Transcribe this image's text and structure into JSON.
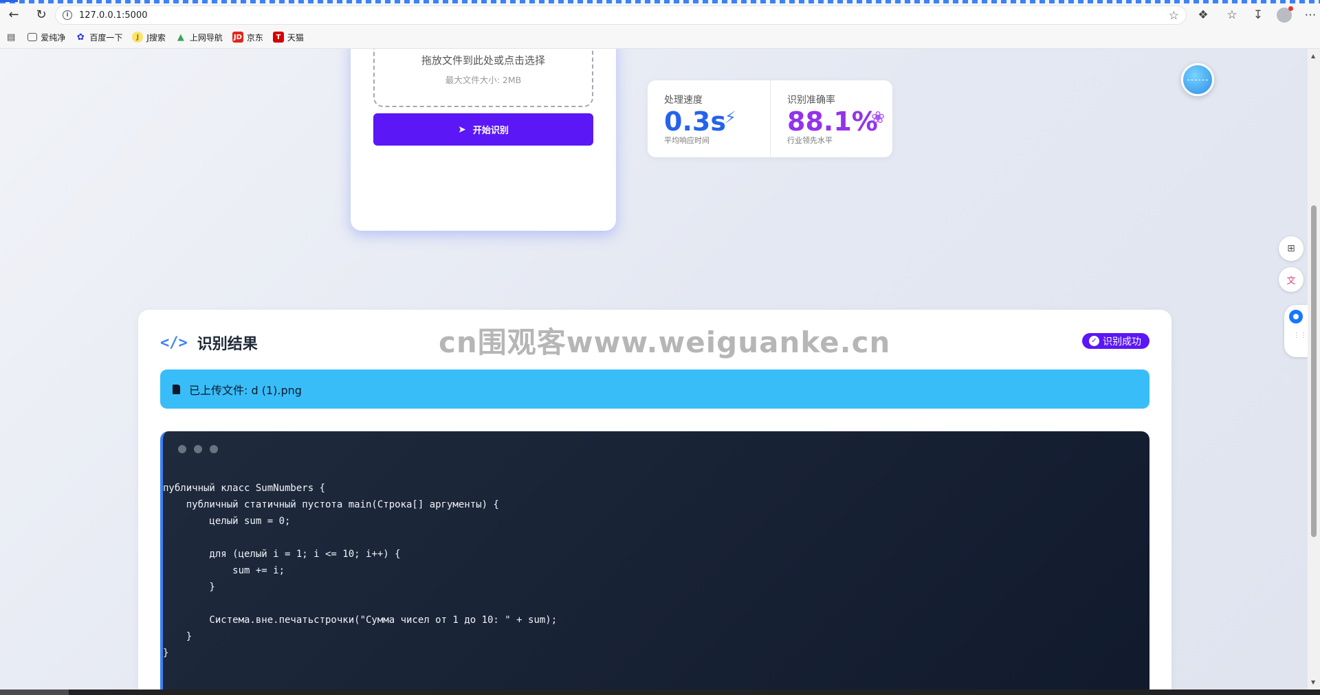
{
  "browser": {
    "url": "127.0.0.1:5000",
    "bookmarks": [
      {
        "label": "爱纯净",
        "icon": "folder-icon",
        "color": "#555555"
      },
      {
        "label": "百度一下",
        "icon": "baidu-paw-icon",
        "color": "#2932e1"
      },
      {
        "label": "J搜索",
        "icon": "jsearch-icon",
        "color": "#f5c518"
      },
      {
        "label": "上网导航",
        "icon": "nav-icon",
        "color": "#3aa55a"
      },
      {
        "label": "京东",
        "icon": "jd-icon",
        "color": "#e1251b"
      },
      {
        "label": "天猫",
        "icon": "tmall-icon",
        "color": "#d50000"
      }
    ]
  },
  "upload": {
    "drop_text": "拖放文件到此处或点击选择",
    "max_size": "最大文件大小: 2MB",
    "start_button": "开始识别"
  },
  "stats": {
    "speed": {
      "label": "处理速度",
      "value": "0.3s",
      "desc": "平均响应时间",
      "color": "#2563eb"
    },
    "accuracy": {
      "label": "识别准确率",
      "value": "88.1%",
      "desc": "行业领先水平",
      "color": "#9333ea"
    }
  },
  "result": {
    "title": "识别结果",
    "watermark": "cn围观客www.weiguanke.cn",
    "status": "识别成功",
    "file_label": "已上传文件: d (1).png",
    "code": "публичный класс SumNumbers {\n    публичный статичный пустота main(Строка[] аргументы) {\n        целый sum = 0;\n\n        для (целый i = 1; i <= 10; i++) {\n            sum += i;\n        }\n\n        Система.вне.печатьстрочки(\"Сумма чисел от 1 до 10: \" + sum);\n    }\n}"
  }
}
